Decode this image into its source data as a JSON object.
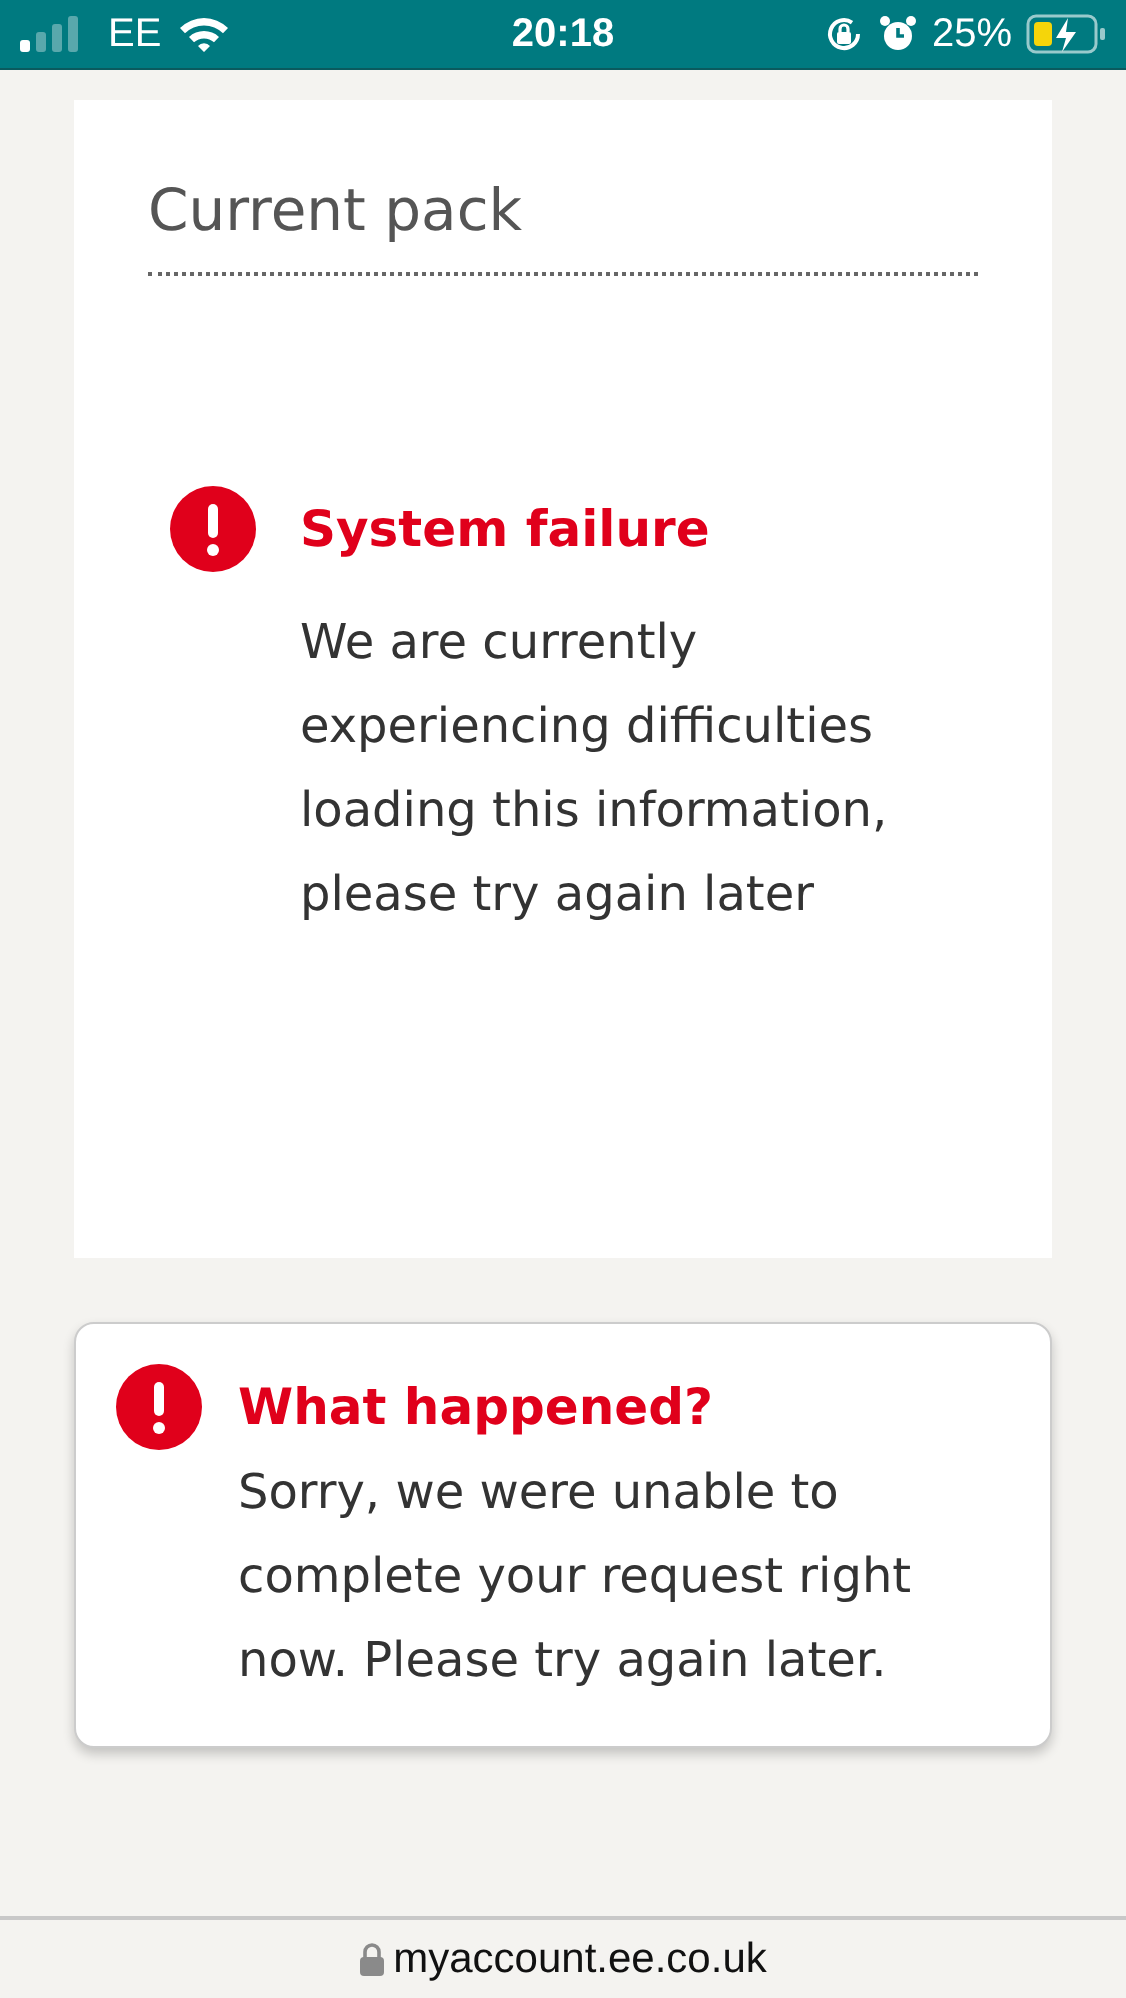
{
  "status_bar": {
    "carrier": "EE",
    "time": "20:18",
    "battery": "25%"
  },
  "current_pack": {
    "title": "Current pack",
    "error": {
      "title": "System failure",
      "message": "We are currently experiencing difficulties loading this information, please try again later"
    }
  },
  "alert": {
    "title": "What happened?",
    "message": "Sorry, we were unable to complete your request right now. Please try again later."
  },
  "address_bar": {
    "url": "myaccount.ee.co.uk"
  }
}
